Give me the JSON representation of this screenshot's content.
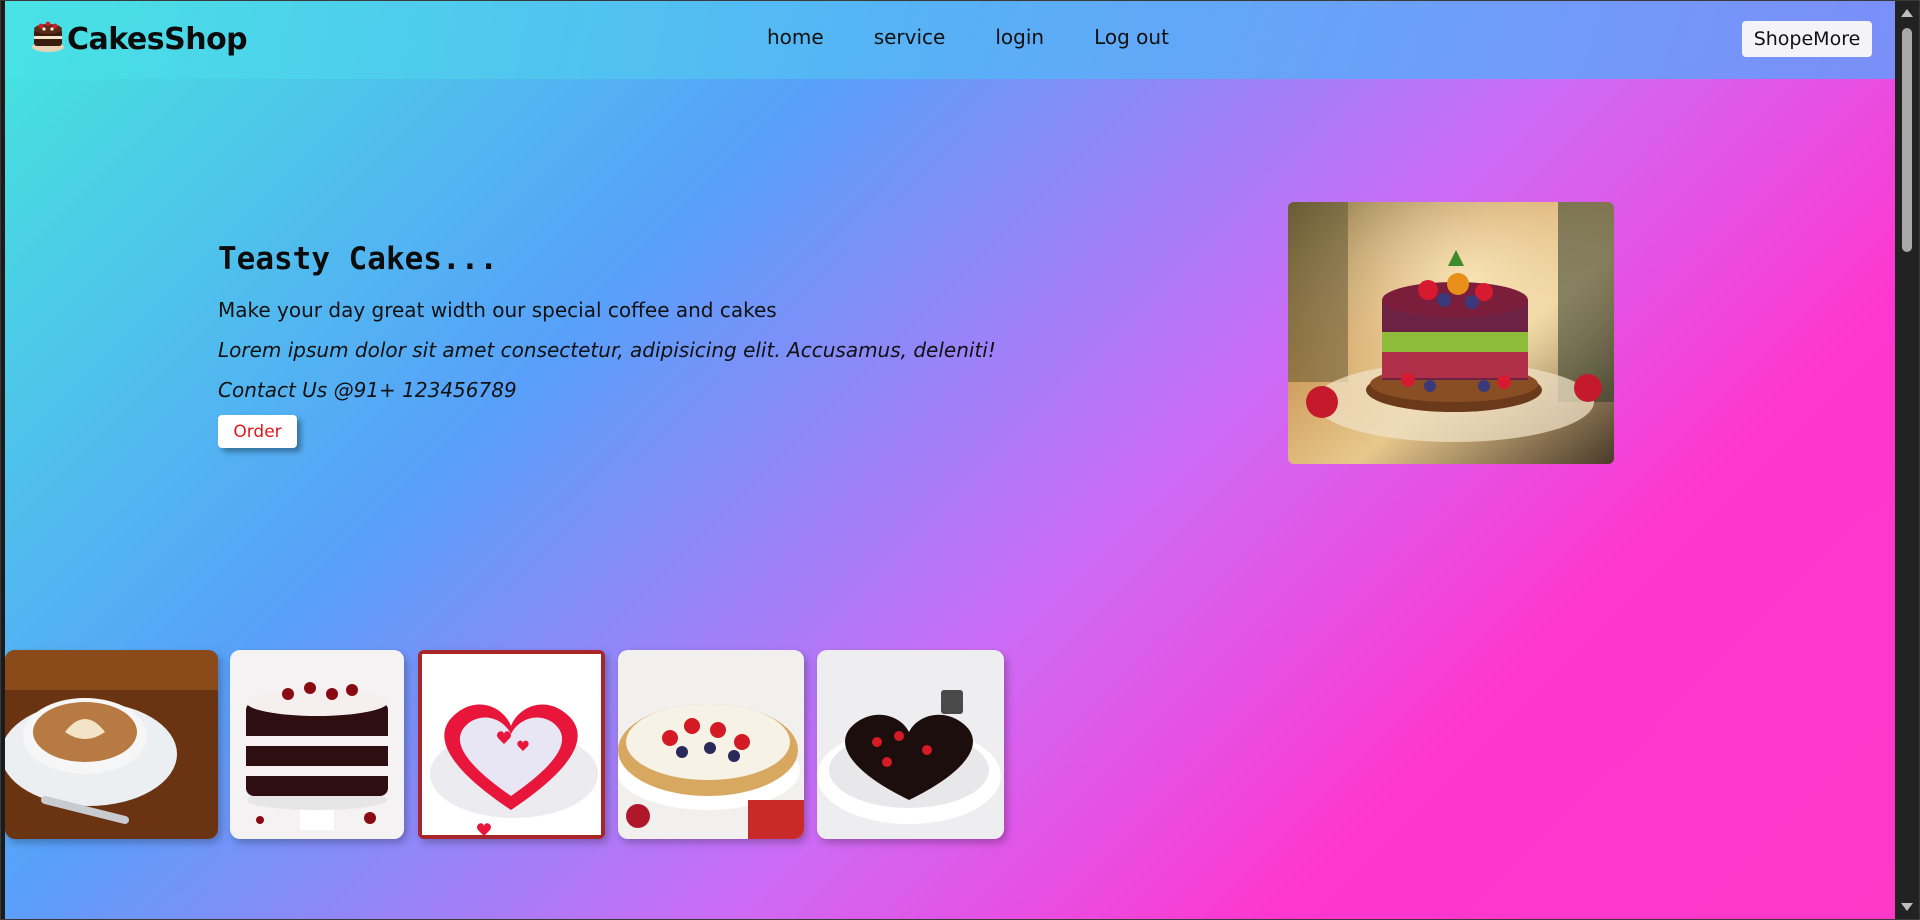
{
  "navbar": {
    "brand": "CakesShop",
    "links": [
      "home",
      "service",
      "login",
      "Log out"
    ],
    "shop_button": "ShopeMore"
  },
  "hero": {
    "title": "Teasty Cakes...",
    "subtitle": "Make your day great width our special coffee and cakes",
    "lorem": "Lorem ipsum dolor sit amet consectetur, adipisicing elit. Accusamus, deleniti!",
    "contact": "Contact Us @91+ 123456789",
    "order_button": "Order"
  },
  "icons": {
    "logo": "cake-logo-icon"
  },
  "gallery": [
    "coffee-latte",
    "black-forest-cake",
    "heart-cake",
    "berry-cheesecake",
    "chocolate-heart-cake"
  ],
  "colors": {
    "gradient_start": "#44e6dc",
    "gradient_mid": "#58a0fa",
    "gradient_end": "#ff36cf",
    "order_text": "#e0161c"
  }
}
